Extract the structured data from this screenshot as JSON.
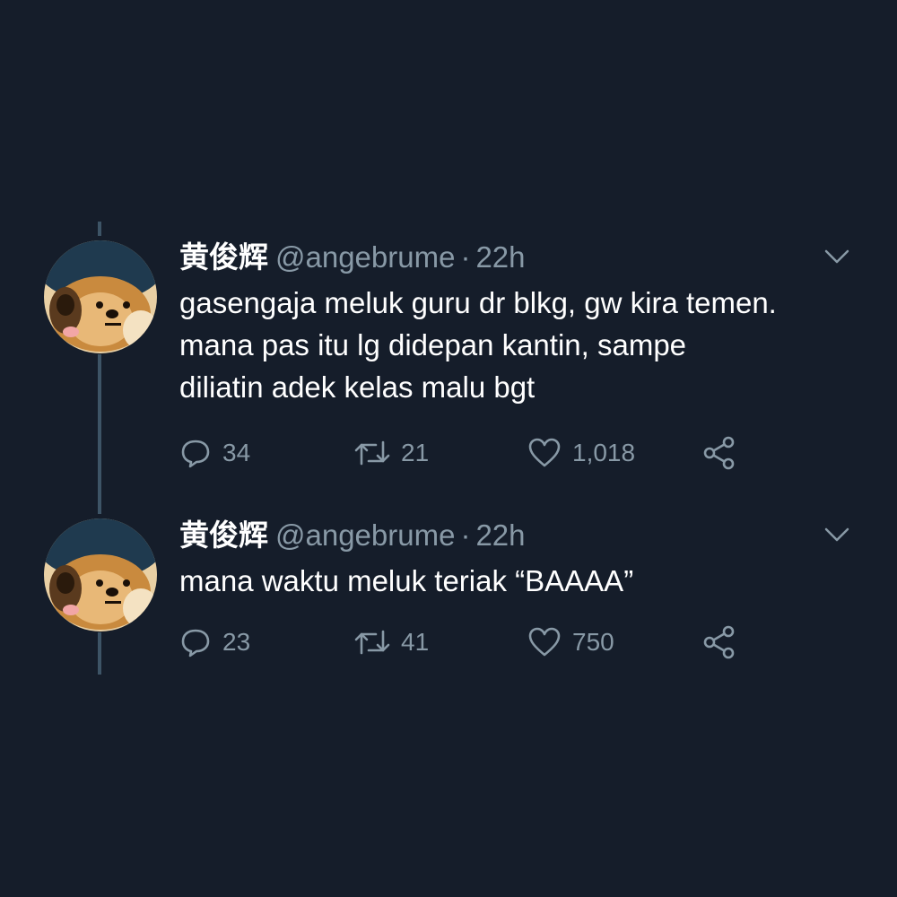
{
  "colors": {
    "background": "#151d2a",
    "text_primary": "#ffffff",
    "text_secondary": "#8899a6",
    "thread_line": "#3d5466"
  },
  "icons": {
    "reply": "speech-bubble",
    "retweet": "retweet-arrows",
    "like": "heart-outline",
    "share": "share-nodes",
    "caret": "chevron-down"
  },
  "tweets": [
    {
      "display_name": "黄俊辉",
      "handle": "@angebrume",
      "separator": "·",
      "time": "22h",
      "lines": [
        "gasengaja meluk guru dr blkg, gw kira temen.",
        "mana pas itu lg didepan kantin, sampe",
        "diliatin adek kelas malu bgt"
      ],
      "replies": "34",
      "retweets": "21",
      "likes": "1,018"
    },
    {
      "display_name": "黄俊辉",
      "handle": "@angebrume",
      "separator": "·",
      "time": "22h",
      "lines": [
        "mana waktu meluk teriak “BAAAA”"
      ],
      "replies": "23",
      "retweets": "41",
      "likes": "750"
    }
  ]
}
